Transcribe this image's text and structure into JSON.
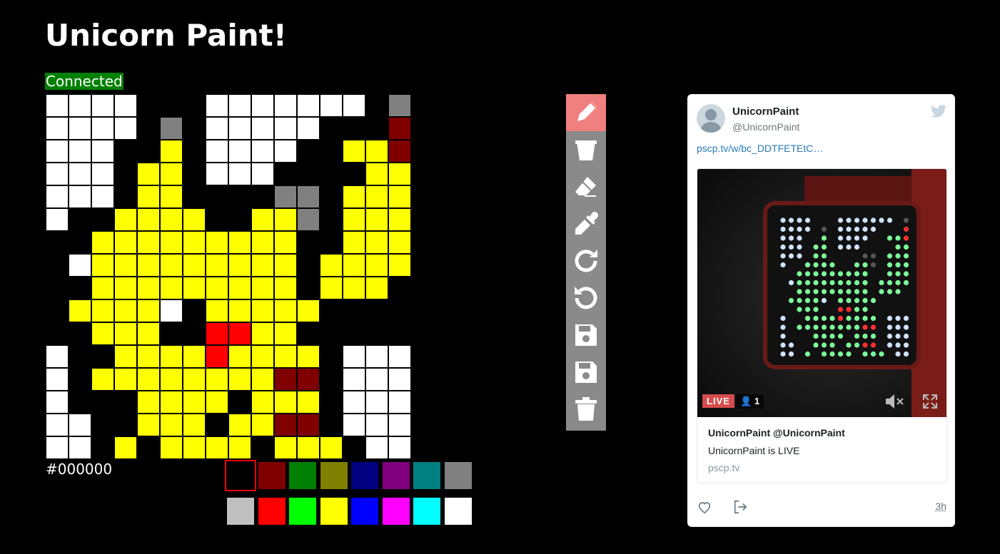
{
  "title": "Unicorn Paint!",
  "status": {
    "text": "Connected",
    "color": "#008000"
  },
  "current_color": "#000000",
  "grid": {
    "legend": {
      "W": "#FFFFFF",
      "K": "#000000",
      "G": "#808080",
      "M": "#800000",
      "Y": "#FFFF00",
      "R": "#FF0000"
    },
    "rows": [
      "WWWWKKKWWWWWWWKG",
      "WWWWKGKWWWWWKKKM",
      "WWWKKYKWWWWKKYYM",
      "WWWKYYKWWWKKKKYY",
      "WWWKYYKKKKGGKYYY",
      "WKKYYYYKKYYGKYYY",
      "KKYYYYYYYYYKKYYY",
      "KWYYYYYYYYYKYYYY",
      "KKYYYYYYYYYKYYYK",
      "KYYYYWKYYYYYKKKK",
      "KKYYYKKRRYYKKKKK",
      "WKKYYYYRYYYYKWWW",
      "WKYYYYYYYYMMKWWW",
      "WKKKYYYYKYYYKWWW",
      "WWKKYYYKYYMMKWWW",
      "WWKYKYYYYKYYYKWW"
    ]
  },
  "palette": {
    "row1": [
      "#000000",
      "#800000",
      "#008000",
      "#808000",
      "#000080",
      "#800080",
      "#008080",
      "#808080"
    ],
    "row2": [
      "#C0C0C0",
      "#FF0000",
      "#00FF00",
      "#FFFF00",
      "#0000FF",
      "#FF00FF",
      "#00FFFF",
      "#FFFFFF"
    ]
  },
  "tools": [
    {
      "icon": "pencil-icon",
      "active": true
    },
    {
      "icon": "bucket-icon",
      "active": false
    },
    {
      "icon": "eraser-icon",
      "active": false
    },
    {
      "icon": "eyedropper-icon",
      "active": false
    },
    {
      "icon": "redo-icon",
      "active": false
    },
    {
      "icon": "undo-icon",
      "active": false
    },
    {
      "icon": "save-icon",
      "active": false
    },
    {
      "icon": "save-icon",
      "active": false
    },
    {
      "icon": "trash-icon",
      "active": false
    }
  ],
  "tweet": {
    "username": "UnicornPaint",
    "handle": "@UnicornPaint",
    "link": "pscp.tv/w/bc_DDTFETEtC…",
    "live_label": "LIVE",
    "viewers": "1",
    "card_title": "UnicornPaint @UnicornPaint",
    "card_desc": "UnicornPaint is LIVE",
    "card_domain": "pscp.tv",
    "time": "3h"
  }
}
